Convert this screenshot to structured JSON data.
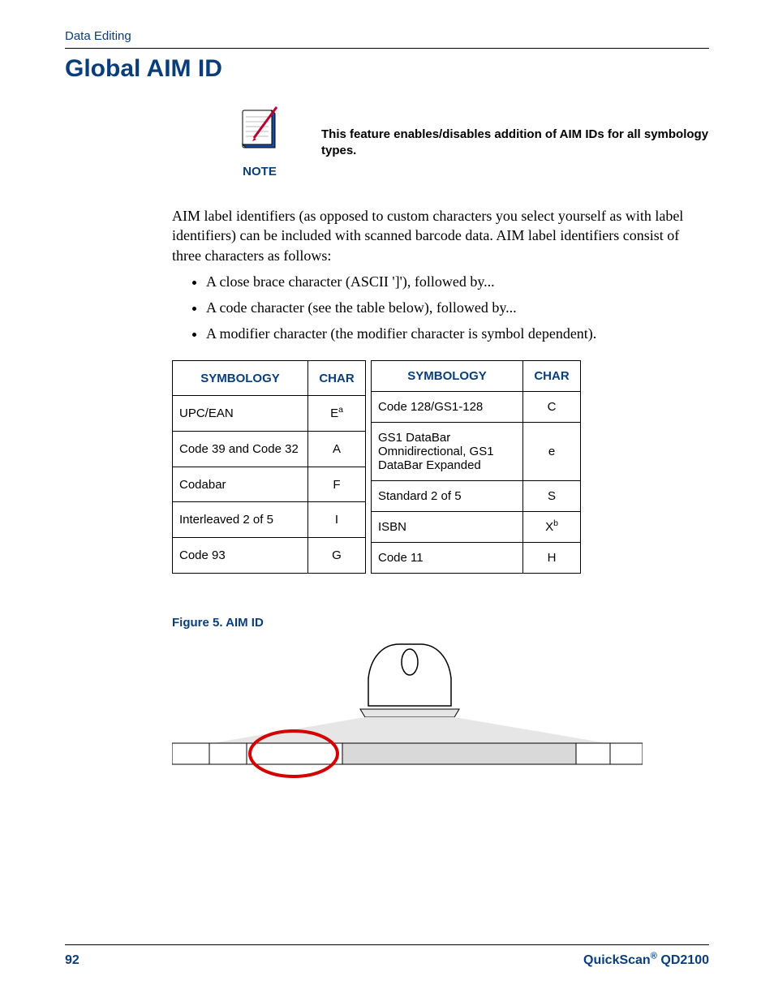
{
  "header": {
    "section": "Data Editing"
  },
  "title": "Global AIM ID",
  "note": {
    "label": "NOTE",
    "text": "This feature enables/disables addition of AIM IDs for all symbology types."
  },
  "paragraph": "AIM label identifiers (as opposed to custom characters you select yourself as with label identifiers) can be included with scanned barcode data. AIM label identifiers consist of three characters as follows:",
  "bullets": {
    "b1": "A close brace character (ASCII ']'), followed by...",
    "b2": "A code character (see the table below), followed by...",
    "b3": "A modifier character (the modifier character is symbol dependent)."
  },
  "table": {
    "head": {
      "sym": "SYMBOLOGY",
      "char": "CHAR"
    },
    "left": [
      {
        "sym": "UPC/EAN",
        "char": "E",
        "sup": "a"
      },
      {
        "sym": "Code 39 and Code 32",
        "char": "A"
      },
      {
        "sym": "Codabar",
        "char": "F"
      },
      {
        "sym": "Interleaved 2 of 5",
        "char": "I"
      },
      {
        "sym": "Code 93",
        "char": "G"
      }
    ],
    "right": [
      {
        "sym": "Code 128/GS1-128",
        "char": "C"
      },
      {
        "sym": "GS1 DataBar Omnidirectional, GS1 DataBar Expanded",
        "char": "e"
      },
      {
        "sym": "Standard 2 of 5",
        "char": "S"
      },
      {
        "sym": "ISBN",
        "char": "X",
        "sup": "b"
      },
      {
        "sym": "Code 11",
        "char": "H"
      }
    ]
  },
  "figure": {
    "label": "Figure 5. AIM ID"
  },
  "footer": {
    "page": "92",
    "product_prefix": "QuickScan",
    "reg": "®",
    "product_suffix": " QD2100"
  }
}
